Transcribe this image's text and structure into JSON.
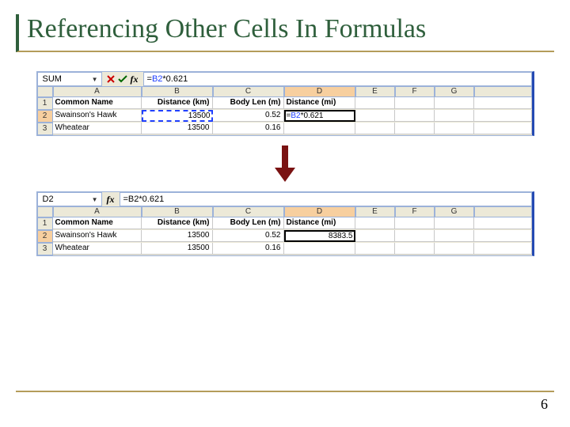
{
  "title": "Referencing Other Cells In Formulas",
  "page_number": "6",
  "columns": [
    "A",
    "B",
    "C",
    "D",
    "E",
    "F",
    "G"
  ],
  "headers": {
    "name": "Common Name",
    "dist_km": "Distance (km)",
    "body_len": "Body Len (m)",
    "dist_mi": "Distance (mi)"
  },
  "rows": [
    {
      "n": "1"
    },
    {
      "n": "2",
      "name": "Swainson's Hawk",
      "dist_km": "13500",
      "body_len": "0.52"
    },
    {
      "n": "3",
      "name": "Wheatear",
      "dist_km": "13500",
      "body_len": "0.16"
    }
  ],
  "panel_top": {
    "namebox": "SUM",
    "formula_prefix": "=",
    "formula_ref": "B2",
    "formula_suffix": "*0.621",
    "icons": {
      "cancel": "✕",
      "confirm": "✓"
    },
    "d2_edit_prefix": "=",
    "d2_edit_ref": "B2",
    "d2_edit_suffix": "*0.621"
  },
  "panel_bottom": {
    "namebox": "D2",
    "formula": "=B2*0.621",
    "d2_result": "8383.5"
  }
}
